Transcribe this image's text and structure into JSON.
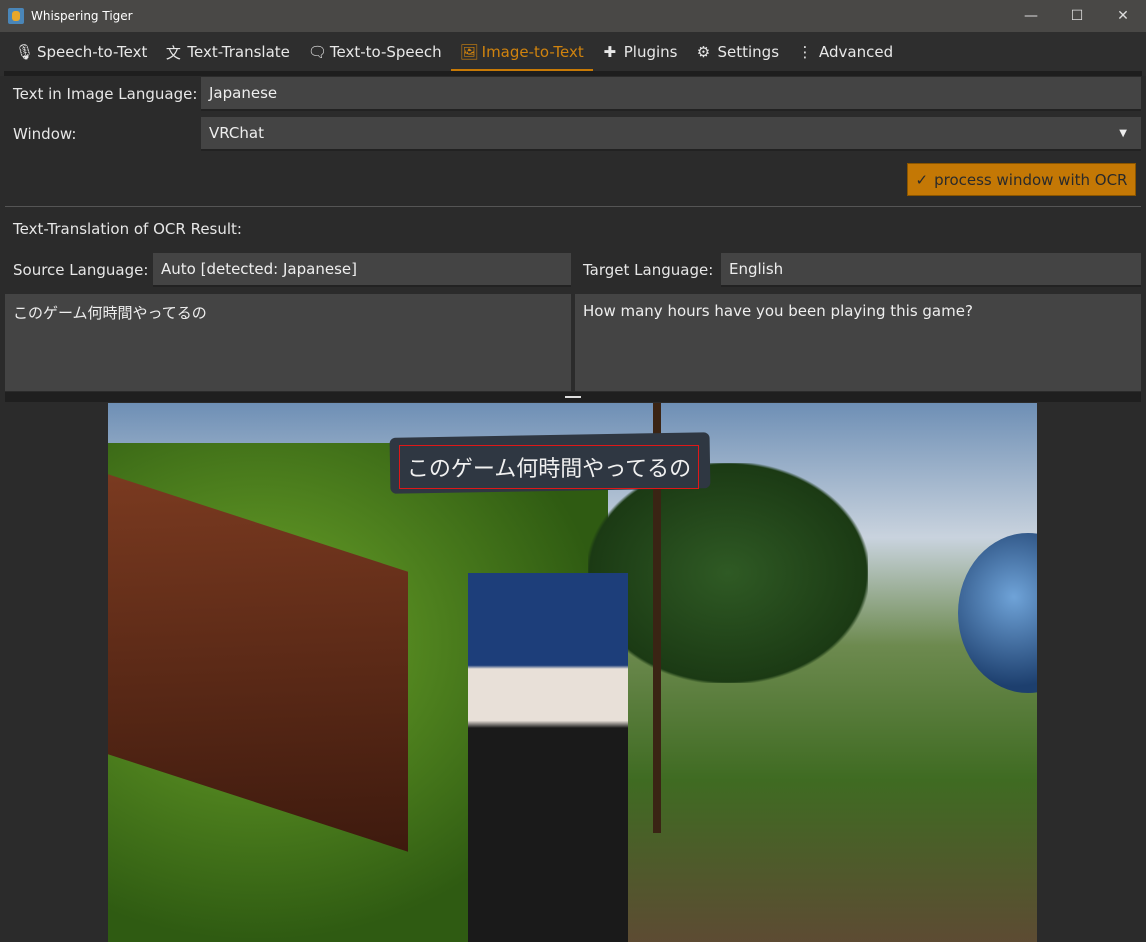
{
  "window": {
    "title": "Whispering Tiger",
    "minimize": "—",
    "maximize": "☐",
    "close": "✕"
  },
  "tabs": [
    {
      "label": "Speech-to-Text",
      "icon": "microphone-chat-icon",
      "glyph": "🎙"
    },
    {
      "label": "Text-Translate",
      "icon": "translate-icon",
      "glyph": "文"
    },
    {
      "label": "Text-to-Speech",
      "icon": "message-icon",
      "glyph": "🗨"
    },
    {
      "label": "Image-to-Text",
      "icon": "image-text-icon",
      "glyph": "🖼",
      "active": true
    },
    {
      "label": "Plugins",
      "icon": "puzzle-icon",
      "glyph": "✚"
    },
    {
      "label": "Settings",
      "icon": "gear-icon",
      "glyph": "⚙"
    },
    {
      "label": "Advanced",
      "icon": "more-vertical-icon",
      "glyph": "⋮"
    }
  ],
  "ocr": {
    "lang_label": "Text in Image Language:",
    "lang_value": "Japanese",
    "window_label": "Window:",
    "window_value": "VRChat",
    "process_button": "process window with OCR",
    "process_icon": "✓"
  },
  "translation": {
    "heading": "Text-Translation of OCR Result:",
    "source_label": "Source Language:",
    "source_value": "Auto [detected: Japanese]",
    "target_label": "Target Language:",
    "target_value": "English",
    "source_text": "このゲーム何時間やってるの",
    "target_text": "How many hours have you been playing this game?"
  },
  "screenshot": {
    "ocr_text": "このゲーム何時間やってるの"
  },
  "colors": {
    "accent": "#c87a06",
    "background": "#2b2b2b",
    "field": "#444444",
    "ocr_box": "#e01818"
  }
}
